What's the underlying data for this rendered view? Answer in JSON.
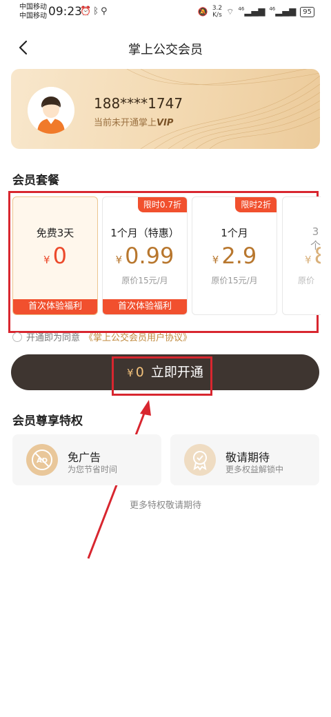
{
  "status_bar": {
    "carrier_1": "中国移动",
    "carrier_2": "中国移动",
    "time": "09:23",
    "net_speed_value": "3.2",
    "net_speed_unit": "K/s",
    "signal_1": "46",
    "signal_2": "46",
    "battery": "95"
  },
  "nav": {
    "title": "掌上公交会员"
  },
  "member_card": {
    "phone": "188****1747",
    "status_text": "当前未开通掌上",
    "vip_text": "VIP"
  },
  "plans_section": {
    "title": "会员套餐",
    "plans": [
      {
        "name": "免费3天",
        "currency": "¥",
        "price": "0",
        "original": "",
        "tag": "",
        "footer": "首次体验福利",
        "selected": true
      },
      {
        "name": "1个月（特惠）",
        "currency": "¥",
        "price": "0.99",
        "original": "原价15元/月",
        "tag": "限时0.7折",
        "footer": "首次体验福利",
        "selected": false
      },
      {
        "name": "1个月",
        "currency": "¥",
        "price": "2.9",
        "original": "原价15元/月",
        "tag": "限时2折",
        "footer": "",
        "selected": false
      },
      {
        "name": "3个",
        "currency": "¥",
        "price": "8",
        "original": "原价",
        "tag": "",
        "footer": "",
        "selected": false
      }
    ]
  },
  "agreement": {
    "prefix": "开通即为同意",
    "link": "《掌上公交会员用户协议》"
  },
  "cta": {
    "currency": "¥",
    "price": "0",
    "label": "立即开通"
  },
  "privileges": {
    "title": "会员尊享特权",
    "items": [
      {
        "title": "免广告",
        "subtitle": "为您节省时间",
        "icon": "ad-free-icon",
        "icon_text": "AD"
      },
      {
        "title": "敬请期待",
        "subtitle": "更多权益解锁中",
        "icon": "medal-icon"
      }
    ],
    "more_note": "更多特权敬请期待"
  },
  "colors": {
    "accent_orange": "#f1502e",
    "gold_text": "#b8772e",
    "cta_bg": "#3e3530",
    "annotation_red": "#d8262f"
  }
}
